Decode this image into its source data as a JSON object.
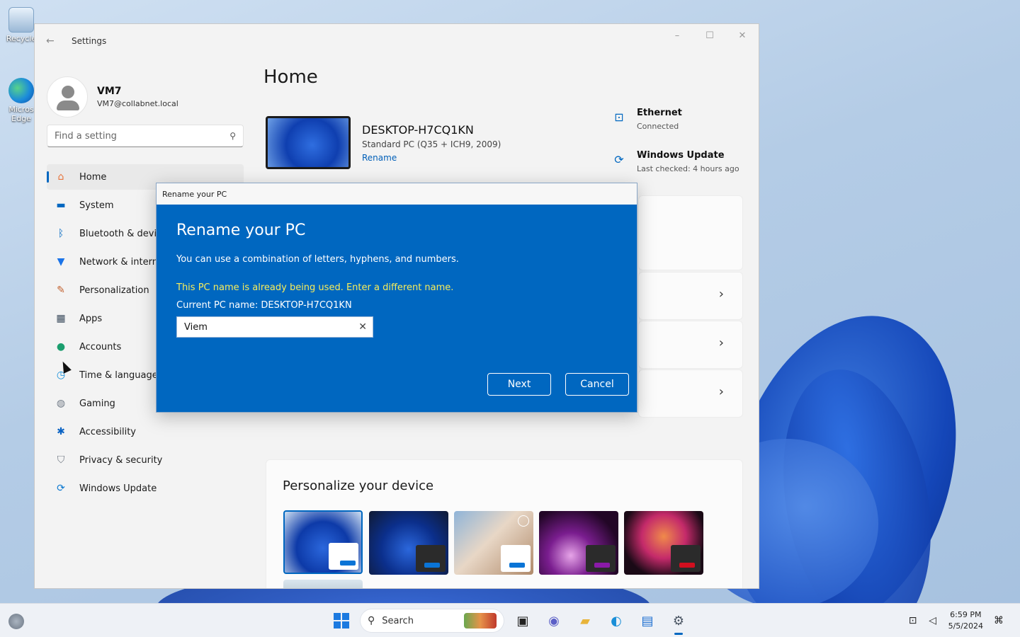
{
  "desktop": {
    "icons": [
      {
        "label": "Recycle"
      },
      {
        "label": "Micros Edge"
      }
    ]
  },
  "window": {
    "title": "Settings",
    "controls": {
      "minimize": "–",
      "maximize": "☐",
      "close": "✕"
    }
  },
  "profile": {
    "name": "VM7",
    "email": "VM7@collabnet.local"
  },
  "search": {
    "placeholder": "Find a setting",
    "icon": "search-icon"
  },
  "nav": {
    "items": [
      {
        "label": "Home",
        "icon": "home-icon",
        "color": "#e8743b",
        "active": true
      },
      {
        "label": "System",
        "icon": "monitor-icon",
        "color": "#0067c0"
      },
      {
        "label": "Bluetooth & devices",
        "icon": "bluetooth-icon",
        "color": "#0067c0"
      },
      {
        "label": "Network & internet",
        "icon": "wifi-icon",
        "color": "#1a73e8"
      },
      {
        "label": "Personalization",
        "icon": "brush-icon",
        "color": "#c2612f"
      },
      {
        "label": "Apps",
        "icon": "apps-icon",
        "color": "#3a4a5c"
      },
      {
        "label": "Accounts",
        "icon": "person-icon",
        "color": "#1b9e6e"
      },
      {
        "label": "Time & language",
        "icon": "globe-clock-icon",
        "color": "#0b8ad8"
      },
      {
        "label": "Gaming",
        "icon": "gamepad-icon",
        "color": "#707a86"
      },
      {
        "label": "Accessibility",
        "icon": "accessibility-icon",
        "color": "#0a63c4"
      },
      {
        "label": "Privacy & security",
        "icon": "shield-icon",
        "color": "#6f7782"
      },
      {
        "label": "Windows Update",
        "icon": "update-icon",
        "color": "#0b78d0"
      }
    ]
  },
  "main": {
    "title": "Home",
    "device": {
      "name": "DESKTOP-H7CQ1KN",
      "spec": "Standard PC (Q35 + ICH9, 2009)",
      "rename": "Rename"
    },
    "status": [
      {
        "title": "Ethernet",
        "sub": "Connected",
        "icon": "ethernet-icon"
      },
      {
        "title": "Windows Update",
        "sub": "Last checked: 4 hours ago",
        "icon": "update-icon"
      }
    ],
    "personalize": {
      "title": "Personalize your device"
    }
  },
  "dialog": {
    "window_title": "Rename your PC",
    "heading": "Rename your PC",
    "description": "You can use a combination of letters, hyphens, and numbers.",
    "warning": "This PC name is already being used. Enter a different name.",
    "current_name": "Current PC name: DESKTOP-H7CQ1KN",
    "input_value": "Viem",
    "clear_icon": "✕",
    "next_label": "Next",
    "cancel_label": "Cancel",
    "colors": {
      "background": "#0067c0",
      "warning": "#f7ec5a"
    }
  },
  "taskbar": {
    "search_label": "Search",
    "time": "6:59 PM",
    "date": "5/5/2024"
  }
}
